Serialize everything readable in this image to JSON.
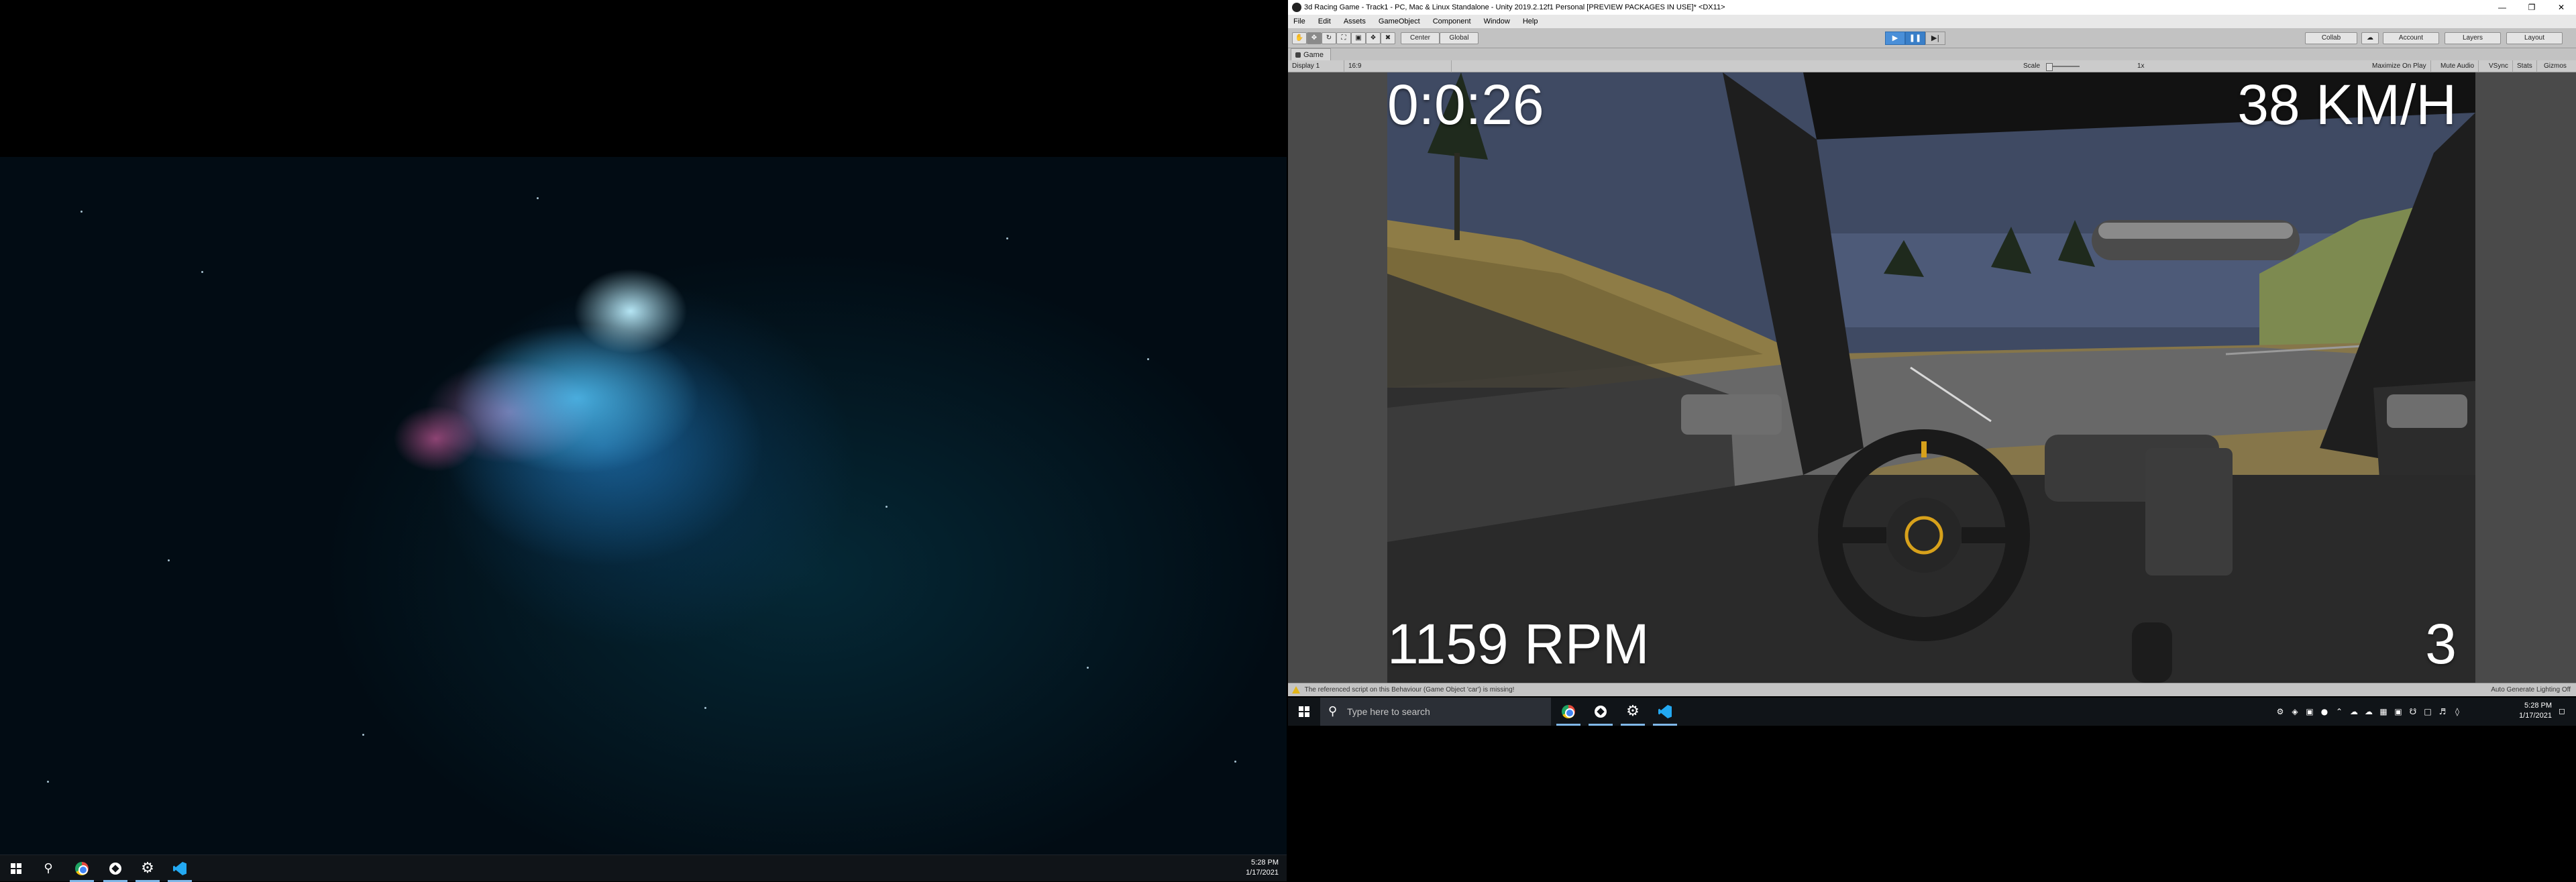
{
  "left_monitor": {
    "taskbar": {
      "apps": [
        "start",
        "search",
        "chrome",
        "unity",
        "settings",
        "vscode"
      ],
      "clock_time": "5:28 PM",
      "clock_date": "1/17/2021"
    }
  },
  "unity": {
    "title": "3d Racing Game - Track1 - PC, Mac & Linux Standalone - Unity 2019.2.12f1 Personal [PREVIEW PACKAGES IN USE]* <DX11>",
    "menu": [
      "File",
      "Edit",
      "Assets",
      "GameObject",
      "Component",
      "Window",
      "Help"
    ],
    "toolbar": {
      "pivot": "Center",
      "space": "Global",
      "collab": "Collab",
      "account": "Account",
      "layers": "Layers",
      "layout": "Layout"
    },
    "game_tab": "Game",
    "game_controls": {
      "display": "Display 1",
      "aspect": "16:9",
      "scale_label": "Scale",
      "scale_value": "1x",
      "maximize": "Maximize On Play",
      "mute": "Mute Audio",
      "vsync": "VSync",
      "stats": "Stats",
      "gizmos": "Gizmos"
    },
    "hud": {
      "timer": "0:0:26",
      "speed": "38 KM/H",
      "rpm": "1159 RPM",
      "gear": "3"
    },
    "status": {
      "warning": "The referenced script on this Behaviour (Game Object 'car') is missing!",
      "lighting": "Auto Generate Lighting Off"
    }
  },
  "right_monitor": {
    "taskbar": {
      "search_placeholder": "Type here to search",
      "apps": [
        "chrome",
        "unity",
        "settings",
        "vscode"
      ],
      "clock_time": "5:28 PM",
      "clock_date": "1/17/2021"
    }
  }
}
